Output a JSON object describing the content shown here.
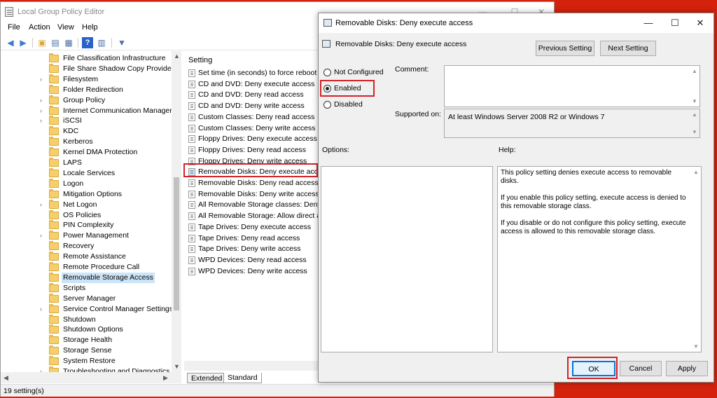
{
  "editor": {
    "title": "Local Group Policy Editor",
    "window_buttons": {
      "minimize": "—",
      "maximize": "☐",
      "close": "✕"
    },
    "menu": [
      "File",
      "Action",
      "View",
      "Help"
    ],
    "toolbar_icons": [
      "back-arrow-icon",
      "forward-arrow-icon",
      "folder-up-icon",
      "show-hide-tree-icon",
      "export-list-icon",
      "help-icon",
      "properties-icon",
      "filter-icon"
    ],
    "tree_items": [
      {
        "label": "File Classification Infrastructure",
        "expandable": false
      },
      {
        "label": "File Share Shadow Copy Provider",
        "expandable": false
      },
      {
        "label": "Filesystem",
        "expandable": true
      },
      {
        "label": "Folder Redirection",
        "expandable": false
      },
      {
        "label": "Group Policy",
        "expandable": true
      },
      {
        "label": "Internet Communication Managem",
        "expandable": true
      },
      {
        "label": "iSCSI",
        "expandable": true
      },
      {
        "label": "KDC",
        "expandable": false
      },
      {
        "label": "Kerberos",
        "expandable": false
      },
      {
        "label": "Kernel DMA Protection",
        "expandable": false
      },
      {
        "label": "LAPS",
        "expandable": false
      },
      {
        "label": "Locale Services",
        "expandable": false
      },
      {
        "label": "Logon",
        "expandable": false
      },
      {
        "label": "Mitigation Options",
        "expandable": false
      },
      {
        "label": "Net Logon",
        "expandable": true
      },
      {
        "label": "OS Policies",
        "expandable": false
      },
      {
        "label": "PIN Complexity",
        "expandable": false
      },
      {
        "label": "Power Management",
        "expandable": true
      },
      {
        "label": "Recovery",
        "expandable": false
      },
      {
        "label": "Remote Assistance",
        "expandable": false
      },
      {
        "label": "Remote Procedure Call",
        "expandable": false
      },
      {
        "label": "Removable Storage Access",
        "expandable": false,
        "selected": true
      },
      {
        "label": "Scripts",
        "expandable": false
      },
      {
        "label": "Server Manager",
        "expandable": false
      },
      {
        "label": "Service Control Manager Settings",
        "expandable": true
      },
      {
        "label": "Shutdown",
        "expandable": false
      },
      {
        "label": "Shutdown Options",
        "expandable": false
      },
      {
        "label": "Storage Health",
        "expandable": false
      },
      {
        "label": "Storage Sense",
        "expandable": false
      },
      {
        "label": "System Restore",
        "expandable": false
      },
      {
        "label": "Troubleshooting and Diagnostics",
        "expandable": true
      }
    ],
    "list_header": "Setting",
    "settings": [
      "Set time (in seconds) to force reboot",
      "CD and DVD: Deny execute access",
      "CD and DVD: Deny read access",
      "CD and DVD: Deny write access",
      "Custom Classes: Deny read access",
      "Custom Classes: Deny write access",
      "Floppy Drives: Deny execute access",
      "Floppy Drives: Deny read access",
      "Floppy Drives: Deny write access",
      "Removable Disks: Deny execute access",
      "Removable Disks: Deny read access",
      "Removable Disks: Deny write access",
      "All Removable Storage classes: Deny all",
      "All Removable Storage: Allow direct acc",
      "Tape Drives: Deny execute access",
      "Tape Drives: Deny read access",
      "Tape Drives: Deny write access",
      "WPD Devices: Deny read access",
      "WPD Devices: Deny write access"
    ],
    "selected_setting": "Removable Disks: Deny execute access",
    "tabs": [
      "Extended",
      "Standard"
    ],
    "active_tab": "Standard",
    "status": "19 setting(s)"
  },
  "dialog": {
    "title": "Removable Disks: Deny execute access",
    "header_name": "Removable Disks: Deny execute access",
    "window_buttons": {
      "minimize": "—",
      "maximize": "☐",
      "close": "✕"
    },
    "prev_button": "Previous Setting",
    "next_button": "Next Setting",
    "radios": {
      "not_configured": "Not Configured",
      "enabled": "Enabled",
      "disabled": "Disabled"
    },
    "selected_radio": "Enabled",
    "comment_label": "Comment:",
    "comment_value": "",
    "supported_label": "Supported on:",
    "supported_value": "At least Windows Server 2008 R2 or Windows 7",
    "options_label": "Options:",
    "help_label": "Help:",
    "help_paragraphs": [
      "This policy setting denies execute access to removable disks.",
      "If you enable this policy setting, execute access is denied to this removable storage class.",
      "If you disable or do not configure this policy setting, execute access is allowed to this removable storage class."
    ],
    "ok_button": "OK",
    "cancel_button": "Cancel",
    "apply_button": "Apply"
  },
  "colors": {
    "highlight": "#d4222a",
    "background": "#d4220c",
    "selection": "#cce4f7"
  }
}
